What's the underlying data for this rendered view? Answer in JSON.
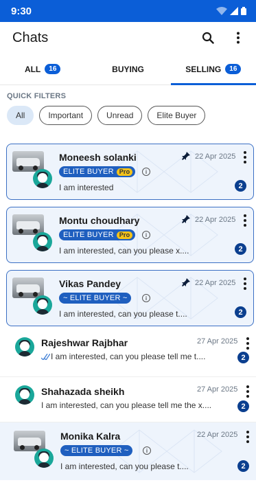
{
  "status_bar": {
    "time": "9:30"
  },
  "header": {
    "title": "Chats",
    "search_icon": "search-icon",
    "menu_icon": "more-vertical-icon"
  },
  "tabs": [
    {
      "label": "ALL",
      "count": "16",
      "active": false
    },
    {
      "label": "BUYING",
      "count": "",
      "active": false
    },
    {
      "label": "SELLING",
      "count": "16",
      "active": true
    }
  ],
  "filters": {
    "title": "QUICK FILTERS",
    "chips": [
      {
        "label": "All",
        "active": true
      },
      {
        "label": "Important",
        "active": false
      },
      {
        "label": "Unread",
        "active": false
      },
      {
        "label": "Elite Buyer",
        "active": false
      }
    ]
  },
  "chats": [
    {
      "name": "Moneesh solanki",
      "badge": "ELITE BUYER",
      "pro": "Pro",
      "date": "22 Apr 2025",
      "message": "I am interested",
      "unread": "2",
      "pinned": true
    },
    {
      "name": "Montu choudhary",
      "badge": "ELITE BUYER",
      "pro": "Pro",
      "date": "22 Apr 2025",
      "message": "I am interested, can you please x....",
      "unread": "2",
      "pinned": true
    },
    {
      "name": "Vikas Pandey",
      "badge": "~ ELITE BUYER ~",
      "date": "22 Apr 2025",
      "message": "I am interested, can you please t....",
      "unread": "2",
      "pinned": true
    },
    {
      "name": "Rajeshwar Rajbhar",
      "date": "27 Apr 2025",
      "message": "I am interested, can you please tell me t....",
      "unread": "2",
      "sent": true
    },
    {
      "name": "Shahazada sheikh",
      "date": "27 Apr 2025",
      "message": "I am interested, can you please tell me the x....",
      "unread": "2"
    },
    {
      "name": "Monika Kalra",
      "badge": "~ ELITE BUYER ~",
      "date": "22 Apr 2025",
      "message": "I am interested, can you please t....",
      "unread": "2"
    }
  ],
  "colors": {
    "primary": "#0b5ed7",
    "card_bg": "#eef4fc",
    "badge": "#1f5fbf",
    "unread": "#0b3f8f",
    "pro": "#f3c21a"
  }
}
